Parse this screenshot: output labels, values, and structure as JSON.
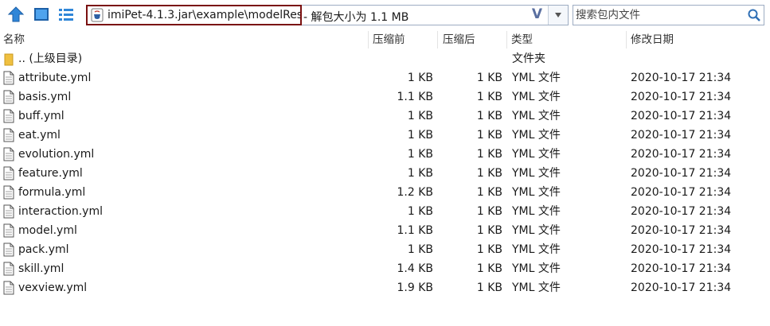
{
  "toolbar": {
    "address_path": "imiPet-4.1.3.jar\\example\\modelRes",
    "address_info": "- 解包大小为 1.1 MB",
    "address_v": "V",
    "search_placeholder": "搜索包内文件"
  },
  "columns": {
    "name": "名称",
    "packed": "压缩前",
    "size": "压缩后",
    "type": "类型",
    "modified": "修改日期"
  },
  "parent_row": {
    "name": ".. (上级目录)",
    "type": "文件夹"
  },
  "files": [
    {
      "name": "attribute.yml",
      "packed": "1 KB",
      "size": "1 KB",
      "type": "YML 文件",
      "modified": "2020-10-17 21:34"
    },
    {
      "name": "basis.yml",
      "packed": "1.1 KB",
      "size": "1 KB",
      "type": "YML 文件",
      "modified": "2020-10-17 21:34"
    },
    {
      "name": "buff.yml",
      "packed": "1 KB",
      "size": "1 KB",
      "type": "YML 文件",
      "modified": "2020-10-17 21:34"
    },
    {
      "name": "eat.yml",
      "packed": "1 KB",
      "size": "1 KB",
      "type": "YML 文件",
      "modified": "2020-10-17 21:34"
    },
    {
      "name": "evolution.yml",
      "packed": "1 KB",
      "size": "1 KB",
      "type": "YML 文件",
      "modified": "2020-10-17 21:34"
    },
    {
      "name": "feature.yml",
      "packed": "1 KB",
      "size": "1 KB",
      "type": "YML 文件",
      "modified": "2020-10-17 21:34"
    },
    {
      "name": "formula.yml",
      "packed": "1.2 KB",
      "size": "1 KB",
      "type": "YML 文件",
      "modified": "2020-10-17 21:34"
    },
    {
      "name": "interaction.yml",
      "packed": "1 KB",
      "size": "1 KB",
      "type": "YML 文件",
      "modified": "2020-10-17 21:34"
    },
    {
      "name": "model.yml",
      "packed": "1.1 KB",
      "size": "1 KB",
      "type": "YML 文件",
      "modified": "2020-10-17 21:34"
    },
    {
      "name": "pack.yml",
      "packed": "1 KB",
      "size": "1 KB",
      "type": "YML 文件",
      "modified": "2020-10-17 21:34"
    },
    {
      "name": "skill.yml",
      "packed": "1.4 KB",
      "size": "1 KB",
      "type": "YML 文件",
      "modified": "2020-10-17 21:34"
    },
    {
      "name": "vexview.yml",
      "packed": "1.9 KB",
      "size": "1 KB",
      "type": "YML 文件",
      "modified": "2020-10-17 21:34"
    }
  ],
  "icons": {
    "up": "arrow-up-icon",
    "view_thumbnail": "thumbnail-view-icon",
    "view_list": "list-view-icon",
    "jar": "jar-file-icon",
    "dropdown": "chevron-down-icon",
    "search": "search-icon",
    "folder": "folder-icon",
    "file": "document-icon"
  },
  "colors": {
    "accent": "#2a7fd4",
    "highlight_border": "#7a1010",
    "folder": "#f0c040"
  }
}
